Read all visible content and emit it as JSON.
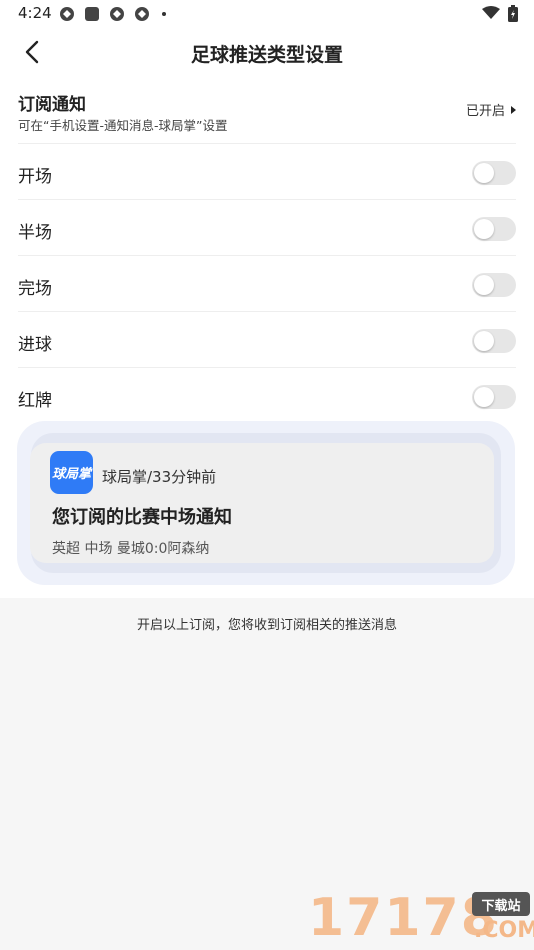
{
  "status_bar": {
    "time": "4:24"
  },
  "nav": {
    "title": "足球推送类型设置"
  },
  "subscription": {
    "title": "订阅通知",
    "desc": "可在“手机设置-通知消息-球局掌”设置",
    "state": "已开启"
  },
  "rows": [
    {
      "label": "开场",
      "enabled": false
    },
    {
      "label": "半场",
      "enabled": false
    },
    {
      "label": "完场",
      "enabled": false
    },
    {
      "label": "进球",
      "enabled": false
    },
    {
      "label": "红牌",
      "enabled": false
    }
  ],
  "preview": {
    "app_icon_text": "球局掌",
    "meta": "球局掌/33分钟前",
    "title": "您订阅的比赛中场通知",
    "body": "英超 中场 曼城0:0阿森纳",
    "icon_color": "#2f7bf6"
  },
  "footer": {
    "text": "开启以上订阅，您将收到订阅相关的推送消息"
  },
  "watermark": {
    "digits": "17178",
    "badge": "下载站",
    "suffix": ".COM"
  }
}
